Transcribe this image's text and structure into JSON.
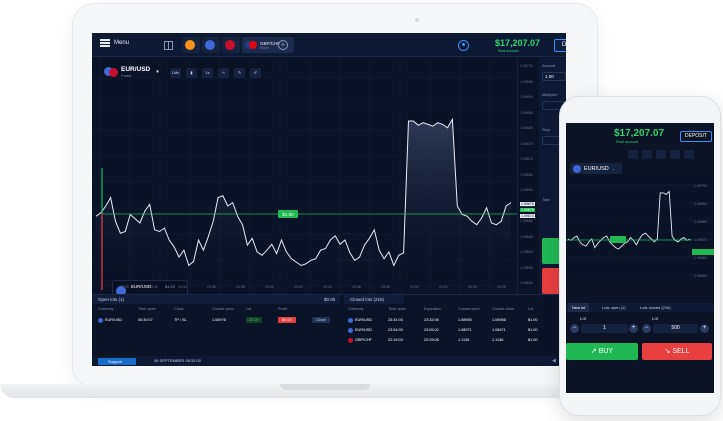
{
  "laptop": {
    "menu_label": "Menu",
    "tab_pair": "GBP/CHF",
    "tab_pair_sub": "Forex",
    "balance": "$17,207.07",
    "balance_sub": "Real account",
    "deposit_label": "Deposit",
    "asset_name": "EUR/USD",
    "asset_type": "Forex",
    "timeframe": "1Mn",
    "tool_1m": "1s",
    "amount_label": "Amount",
    "amount_value": "1.00",
    "multiplier_label": "Multiplier",
    "stop_label": "Stop",
    "take_label": "Take",
    "price_flag": "$1.00",
    "y_ticks": [
      "1.09700",
      "1.09695",
      "1.09690",
      "1.09685",
      "1.09680",
      "1.09675",
      "1.09670",
      "1.09665",
      "1.09660",
      "1.09655",
      "1.09650",
      "1.09645",
      "1.09640",
      "1.09635",
      "1.09630"
    ],
    "y_highlight": [
      "1.09676",
      "1.09675",
      "1.09674"
    ],
    "x_ticks": [
      "23:30",
      "23:32",
      "23:34",
      "23:36",
      "23:38",
      "23:40",
      "23:42",
      "23:44",
      "23:46",
      "23:48",
      "23:50",
      "23:52",
      "00:00",
      "00:05"
    ],
    "mini_trade": {
      "pair": "EUR/USD",
      "price": "$1.00",
      "loss": "-$0.00"
    },
    "open_lots": {
      "title": "Open lots (1)",
      "total": "$0.00",
      "headers": [
        "Currency",
        "Time open",
        "Close",
        "Course open",
        "Lot",
        "Profit"
      ],
      "rows": [
        {
          "currency": "EUR/USD",
          "time_open": "00:30:07",
          "close": "TP / SL",
          "course_open": "1.08976",
          "lot": "$1.00",
          "profit": "$0.00",
          "action": "Close"
        }
      ]
    },
    "closed_lots": {
      "title": "Closed lots (216)",
      "headers": [
        "Currency",
        "Time open",
        "Expiration",
        "Course open",
        "Course close",
        "Lot"
      ],
      "rows": [
        {
          "currency": "EUR/USD",
          "time_open": "23:31:03",
          "expiration": "23:32:06",
          "course_open": "1.08965",
          "course_close": "1.08966",
          "lot": "$1.00"
        },
        {
          "currency": "EUR/USD",
          "time_open": "23:04:03",
          "expiration": "23:05:02",
          "course_open": "1.08971",
          "course_close": "1.08971",
          "lot": "$1.00"
        },
        {
          "currency": "GBP/CHF",
          "time_open": "22:19:03",
          "expiration": "22:29:06",
          "course_open": "1.1136",
          "course_close": "1.1136",
          "lot": "$1.00"
        }
      ]
    },
    "support_label": "Support",
    "datetime": "08 SEPTEMBER 08:32:00",
    "series": [
      172,
      168,
      160,
      150,
      178,
      192,
      190,
      170,
      175,
      180,
      166,
      158,
      188,
      190,
      186,
      200,
      208,
      220,
      212,
      230,
      225,
      200,
      212,
      196,
      178,
      150,
      148,
      160,
      156,
      172,
      182,
      206,
      198,
      214,
      218,
      212,
      205,
      216,
      200,
      214,
      222,
      226,
      230,
      228,
      224,
      222,
      212,
      210,
      200,
      195,
      205,
      200,
      215,
      224,
      220,
      206,
      198,
      188,
      212,
      222,
      214,
      230,
      218,
      215,
      60,
      60,
      65,
      62,
      64,
      66,
      62,
      64,
      68,
      58,
      160,
      170,
      172,
      178,
      182,
      174,
      162,
      180,
      182,
      178,
      160,
      156
    ]
  },
  "phone": {
    "balance": "$17,207.07",
    "balance_sub": "Real account",
    "deposit_label": "DEPOSIT",
    "asset_name": "EUR/USD",
    "tab_new": "New lot",
    "tab_open": "Lots open (1)",
    "tab_closed": "Lots closed (216)",
    "lot_label_1": "Lot",
    "lot_label_2": "Lot",
    "lot_value_1": "1",
    "lot_value_2": "500",
    "buy_label": "BUY",
    "sell_label": "SELL",
    "y_ticks": [
      "1.09700",
      "1.09690",
      "1.09680",
      "1.09670",
      "1.09660",
      "1.09650"
    ],
    "series": [
      100,
      102,
      98,
      96,
      104,
      108,
      110,
      104,
      100,
      112,
      106,
      102,
      98,
      96,
      104,
      108,
      112,
      114,
      110,
      106,
      104,
      98,
      102,
      108,
      100,
      94,
      92,
      96,
      100,
      104,
      100,
      36,
      36,
      38,
      34,
      96,
      102,
      104,
      100,
      98,
      102,
      100
    ]
  }
}
